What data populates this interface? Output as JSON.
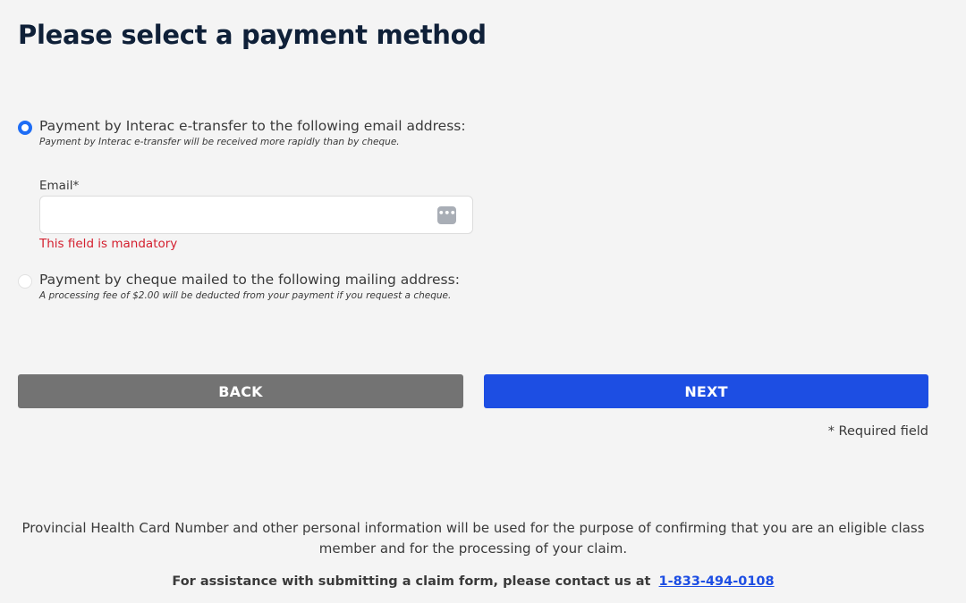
{
  "page": {
    "title": "Please select a payment method"
  },
  "options": [
    {
      "label": "Payment by Interac e-transfer to the following email address:",
      "note": "Payment by Interac e-transfer will be received more rapidly than by cheque.",
      "selected": true
    },
    {
      "label": "Payment by cheque mailed to the following mailing address:",
      "note": "A processing fee of $2.00 will be deducted from your payment if you request a cheque.",
      "selected": false
    }
  ],
  "email_field": {
    "label": "Email*",
    "value": "",
    "placeholder": "",
    "autofill_icon": "•••",
    "error": "This field is mandatory"
  },
  "buttons": {
    "back": "BACK",
    "next": "NEXT"
  },
  "required_note": "* Required field",
  "footer": {
    "privacy": "Provincial Health Card Number and other personal information will be used for the purpose of confirming that you are an eligible class member and for the processing of your claim.",
    "assistance_text": "For assistance with submitting a claim form, please contact us at",
    "phone": "1-833-494-0108"
  },
  "colors": {
    "title": "#0f2038",
    "accent": "#1e6df5",
    "next_button": "#1d4ee3",
    "back_button": "#737373",
    "error": "#d4202f",
    "background": "#f4f4f4"
  }
}
